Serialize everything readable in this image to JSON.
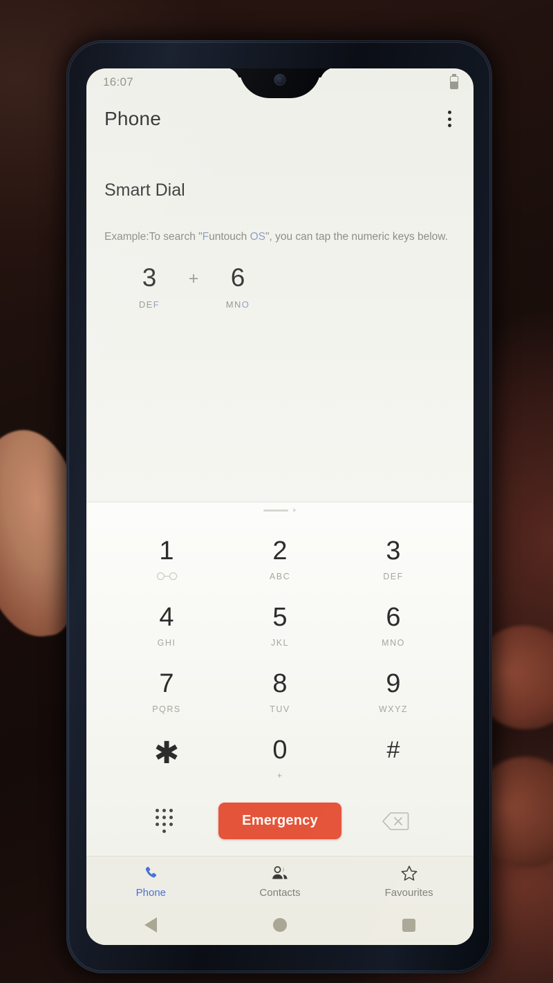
{
  "status_bar": {
    "time": "16:07",
    "battery_icon": "battery-icon"
  },
  "app_bar": {
    "title": "Phone",
    "overflow_icon": "overflow-menu-icon"
  },
  "smart_dial": {
    "title": "Smart Dial",
    "description_parts": {
      "before": "Example:To search \"",
      "highlight_1": "F",
      "middle": "untouch ",
      "highlight_2": "OS",
      "after": "\", you can tap the numeric keys below."
    },
    "example": {
      "plus": "+",
      "keys": [
        {
          "digit": "3",
          "letters_plain": "DE",
          "letters_highlight": "F"
        },
        {
          "digit": "6",
          "letters_plain": "MN",
          "letters_highlight": "O"
        }
      ]
    }
  },
  "keypad": {
    "drag_handle": "drag-handle",
    "keys": [
      {
        "digit": "1",
        "sub": "",
        "icon": "voicemail-icon"
      },
      {
        "digit": "2",
        "sub": "ABC",
        "icon": ""
      },
      {
        "digit": "3",
        "sub": "DEF",
        "icon": ""
      },
      {
        "digit": "4",
        "sub": "GHI",
        "icon": ""
      },
      {
        "digit": "5",
        "sub": "JKL",
        "icon": ""
      },
      {
        "digit": "6",
        "sub": "MNO",
        "icon": ""
      },
      {
        "digit": "7",
        "sub": "PQRS",
        "icon": ""
      },
      {
        "digit": "8",
        "sub": "TUV",
        "icon": ""
      },
      {
        "digit": "9",
        "sub": "WXYZ",
        "icon": ""
      },
      {
        "digit": "✱",
        "sub": "",
        "icon": ""
      },
      {
        "digit": "0",
        "sub": "+",
        "icon": ""
      },
      {
        "digit": "#",
        "sub": "",
        "icon": ""
      }
    ]
  },
  "actions": {
    "dialpad_icon": "dialpad-dots-icon",
    "emergency_label": "Emergency",
    "backspace_icon": "backspace-icon"
  },
  "tabs": [
    {
      "label": "Phone",
      "icon": "phone-icon",
      "active": true
    },
    {
      "label": "Contacts",
      "icon": "contacts-icon",
      "active": false
    },
    {
      "label": "Favourites",
      "icon": "star-icon",
      "active": false
    }
  ],
  "nav_bar": {
    "back": "back-triangle-icon",
    "home": "home-circle-icon",
    "recents": "recents-square-icon"
  },
  "colors": {
    "emergency": "#e4543a",
    "tab_active": "#4a72d6",
    "screen_bg": "#f3f3ee",
    "phone_body": "#141b27"
  }
}
